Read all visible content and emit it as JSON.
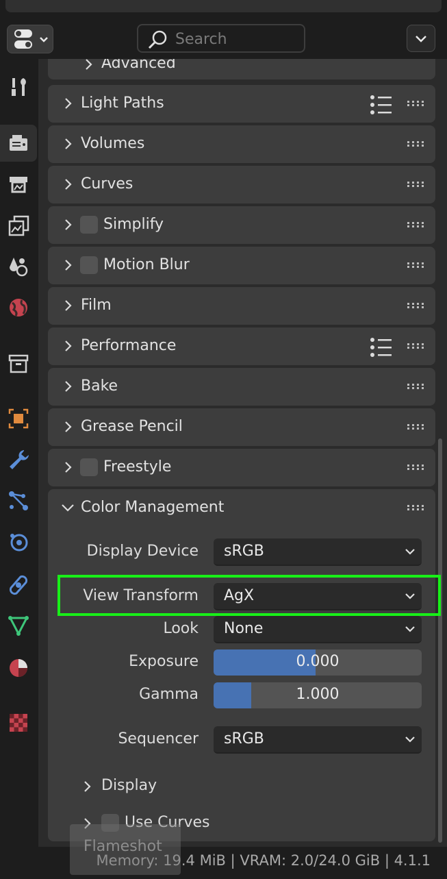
{
  "header": {
    "search_placeholder": "Search"
  },
  "tabs": [
    {
      "name": "tool-icon"
    },
    {
      "name": "render-icon"
    },
    {
      "name": "output-icon"
    },
    {
      "name": "view-layer-icon"
    },
    {
      "name": "scene-icon"
    },
    {
      "name": "world-icon"
    },
    {
      "name": "collection-icon"
    },
    {
      "name": "object-icon"
    },
    {
      "name": "modifier-icon"
    },
    {
      "name": "particles-icon"
    },
    {
      "name": "physics-icon"
    },
    {
      "name": "constraints-icon"
    },
    {
      "name": "data-icon"
    },
    {
      "name": "material-icon"
    },
    {
      "name": "texture-icon"
    }
  ],
  "panels": {
    "advanced": "Advanced",
    "light_paths": "Light Paths",
    "volumes": "Volumes",
    "curves": "Curves",
    "simplify": "Simplify",
    "motion_blur": "Motion Blur",
    "film": "Film",
    "performance": "Performance",
    "bake": "Bake",
    "grease_pencil": "Grease Pencil",
    "freestyle": "Freestyle"
  },
  "color_management": {
    "title": "Color Management",
    "display_device": {
      "label": "Display Device",
      "value": "sRGB"
    },
    "view_transform": {
      "label": "View Transform",
      "value": "AgX"
    },
    "look": {
      "label": "Look",
      "value": "None"
    },
    "exposure": {
      "label": "Exposure",
      "value": "0.000",
      "fill": 0.49
    },
    "gamma": {
      "label": "Gamma",
      "value": "1.000",
      "fill": 0.18
    },
    "sequencer": {
      "label": "Sequencer",
      "value": "sRGB"
    },
    "display_sub": "Display",
    "use_curves": "Use Curves"
  },
  "status": {
    "text": "Memory: 19.4 MiB | VRAM: 2.0/24.0 GiB | 4.1.1",
    "overlay": "Flameshot"
  }
}
